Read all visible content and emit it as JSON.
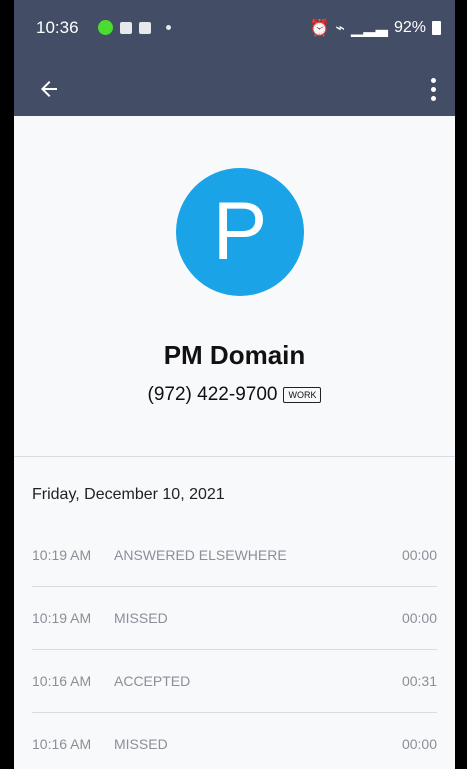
{
  "status_bar": {
    "time": "10:36",
    "right_text": "92%",
    "icons": [
      "green-dot-icon",
      "grid-icon",
      "calendar-icon",
      "alarm-icon",
      "wifi-icon",
      "signal-icon",
      "battery-icon"
    ]
  },
  "app_bar": {
    "back_icon": "arrow-left-icon",
    "menu_icon": "more-vert-icon"
  },
  "contact": {
    "avatar_letter": "P",
    "avatar_color": "#1ba3e8",
    "name": "PM Domain",
    "phone": "(972) 422-9700",
    "phone_type": "WORK"
  },
  "history": {
    "date": "Friday, December 10, 2021",
    "calls": [
      {
        "time": "10:19 AM",
        "status": "ANSWERED ELSEWHERE",
        "duration": "00:00"
      },
      {
        "time": "10:19 AM",
        "status": "MISSED",
        "duration": "00:00"
      },
      {
        "time": "10:16 AM",
        "status": "ACCEPTED",
        "duration": "00:31"
      },
      {
        "time": "10:16 AM",
        "status": "MISSED",
        "duration": "00:00"
      }
    ]
  },
  "colors": {
    "app_bar": "#444d66",
    "screen_bg": "#f8f9fb",
    "text_muted": "#8a8f98"
  }
}
